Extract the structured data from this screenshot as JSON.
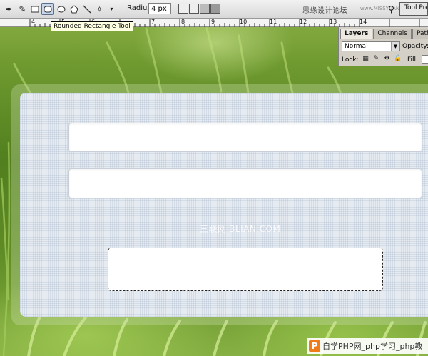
{
  "toolbar": {
    "tool_icons": [
      "pen-icon",
      "freeform-pen-icon",
      "rectangle-tool-icon",
      "rounded-rectangle-tool-icon",
      "ellipse-tool-icon",
      "polygon-tool-icon",
      "line-tool-icon",
      "custom-shape-tool-icon",
      "chevron-down-icon"
    ],
    "radius_label": "Radius:",
    "radius_value": "4 px",
    "site_mark": "思缘设计论坛",
    "site_mark_url": "www.MISSYUAN.COM",
    "tool_presets_label": "Tool Pre"
  },
  "ruler": {
    "numbers": [
      "4",
      "5",
      "6",
      "7",
      "8",
      "9",
      "10",
      "11",
      "12",
      "13",
      "14"
    ]
  },
  "tooltip": {
    "text": "Rounded Rectangle Tool"
  },
  "layers_panel": {
    "tabs": [
      {
        "label": "Layers",
        "active": true
      },
      {
        "label": "Channels",
        "active": false
      },
      {
        "label": "Paths",
        "active": false
      }
    ],
    "blend_mode": "Normal",
    "opacity_label": "Opacity:",
    "lock_label": "Lock:",
    "fill_label": "Fill:"
  },
  "canvas": {
    "watermark": "三联网 3LIAN.COM"
  },
  "badge": {
    "logo": "P",
    "text": "自学PHP网_php学习_php教"
  }
}
